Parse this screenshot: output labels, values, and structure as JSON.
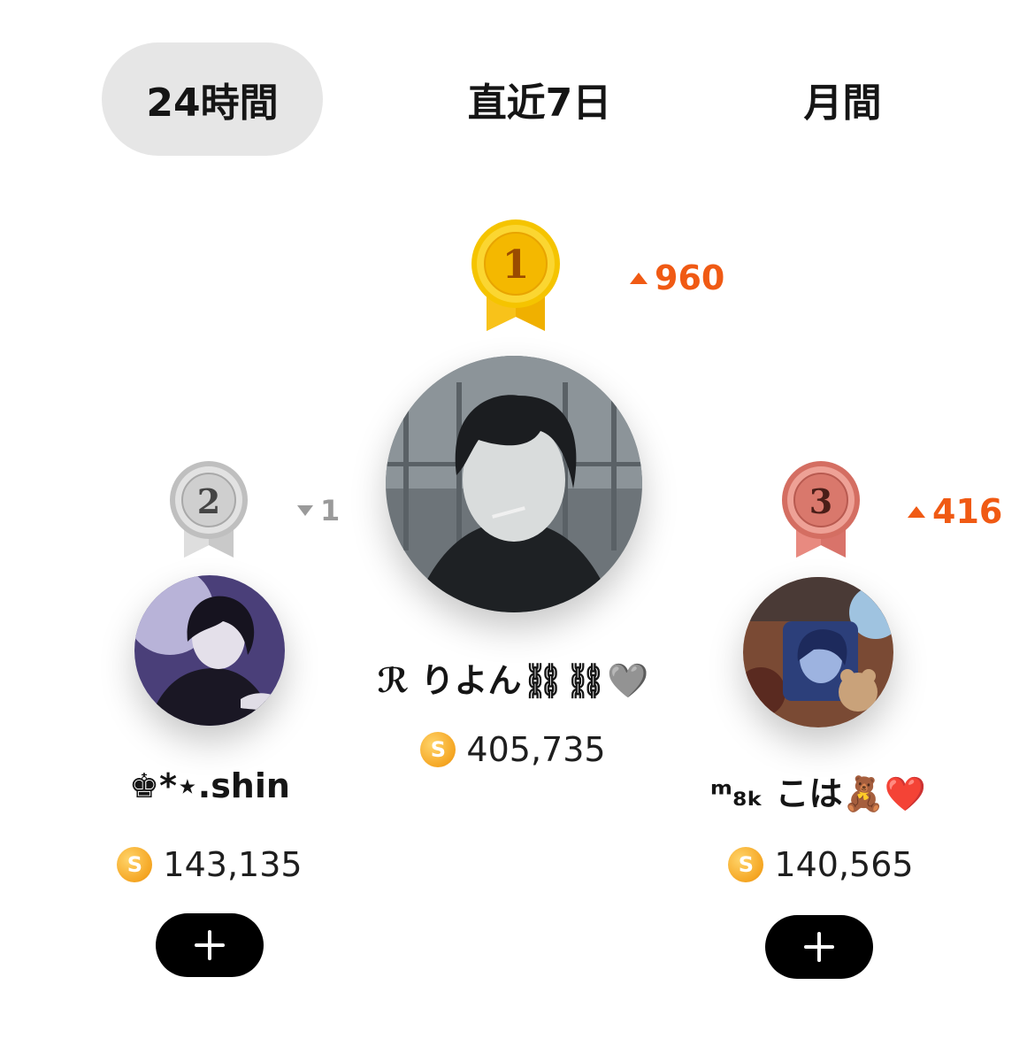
{
  "tabs": [
    {
      "label": "24時間",
      "active": true
    },
    {
      "label": "直近7日",
      "active": false
    },
    {
      "label": "月間",
      "active": false
    }
  ],
  "ranking": [
    {
      "rank": "1",
      "medal": "gold",
      "change_direction": "up",
      "change": "960",
      "name": "ℛ りよん⛓⛓🩶",
      "score": "405,735"
    },
    {
      "rank": "2",
      "medal": "silver",
      "change_direction": "down",
      "change": "1",
      "name": "♚*⋆.shin",
      "score": "143,135"
    },
    {
      "rank": "3",
      "medal": "bronze",
      "change_direction": "up",
      "change": "416",
      "name": "ᵐ₈ₖ こは🧸❤️",
      "score": "140,565"
    }
  ],
  "coin_symbol": "S",
  "colors": {
    "accent_up": "#f05a14",
    "accent_down": "#9a9a9a",
    "tab_active_bg": "#e6e6e6",
    "coin": "#f5a623",
    "button_bg": "#000000"
  },
  "icons": {
    "medal_1": "gold-medal-icon",
    "medal_2": "silver-medal-icon",
    "medal_3": "bronze-medal-icon",
    "coin": "coin-icon",
    "follow": "plus-icon"
  }
}
